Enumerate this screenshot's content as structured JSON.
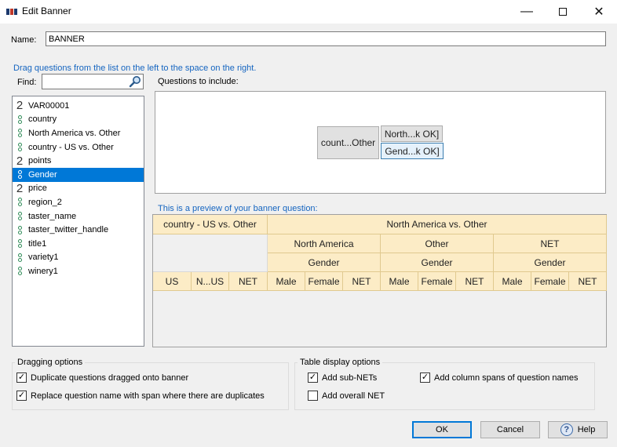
{
  "window": {
    "title": "Edit Banner"
  },
  "name": {
    "label": "Name:",
    "value": "BANNER"
  },
  "hint": "Drag questions from the list on the left to the space on the right.",
  "find": {
    "label": "Find:",
    "value": ""
  },
  "questions": [
    {
      "label": "VAR00001",
      "type": "numeric"
    },
    {
      "label": "country",
      "type": "categorical"
    },
    {
      "label": "North America vs. Other",
      "type": "categorical"
    },
    {
      "label": "country - US vs. Other",
      "type": "categorical"
    },
    {
      "label": "points",
      "type": "numeric"
    },
    {
      "label": "Gender",
      "type": "categorical",
      "selected": true
    },
    {
      "label": "price",
      "type": "numeric"
    },
    {
      "label": "region_2",
      "type": "categorical"
    },
    {
      "label": "taster_name",
      "type": "categorical"
    },
    {
      "label": "taster_twitter_handle",
      "type": "categorical"
    },
    {
      "label": "title1",
      "type": "categorical"
    },
    {
      "label": "variety1",
      "type": "categorical"
    },
    {
      "label": "winery1",
      "type": "categorical"
    }
  ],
  "numeric_icon_glyph": "2",
  "include": {
    "label": "Questions to include:",
    "main_chip": "count...Other",
    "sub_chips": [
      "North...k OK]",
      "Gend...k OK]"
    ]
  },
  "preview": {
    "label": "This is a preview of your banner question:",
    "row1": [
      "country - US vs. Other",
      "North America vs. Other"
    ],
    "row2": [
      "North America",
      "Other",
      "NET"
    ],
    "row3": [
      "Gender",
      "Gender",
      "Gender"
    ],
    "row4": [
      "US",
      "N...US",
      "NET",
      "Male",
      "Female",
      "NET",
      "Male",
      "Female",
      "NET",
      "Male",
      "Female",
      "NET"
    ]
  },
  "dragging_options": {
    "title": "Dragging options",
    "opt1": {
      "label": "Duplicate questions dragged onto banner",
      "checked": true
    },
    "opt2": {
      "label": "Replace question name with span where there are duplicates",
      "checked": true
    }
  },
  "table_display_options": {
    "title": "Table display options",
    "opt1": {
      "label": "Add sub-NETs",
      "checked": true
    },
    "opt2": {
      "label": "Add column spans of question names",
      "checked": true
    },
    "opt3": {
      "label": "Add overall NET",
      "checked": false
    }
  },
  "buttons": {
    "ok": "OK",
    "cancel": "Cancel",
    "help": "Help"
  },
  "check_glyph": "✓",
  "colors": {
    "selection": "#0078d7",
    "hint_text": "#1565c0",
    "preview_cell": "#fcecc6"
  }
}
